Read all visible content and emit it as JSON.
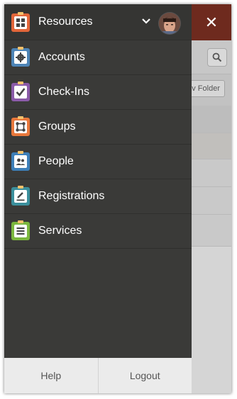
{
  "header": {
    "title": "Resources",
    "close_glyph": "✕"
  },
  "app_background": {
    "new_folder_label": "v Folder",
    "header_color": "#6e2a1e"
  },
  "menu": {
    "items": [
      {
        "label": "Resources",
        "icon": "resources-grid-icon",
        "color": "#e2663a"
      },
      {
        "label": "Accounts",
        "icon": "accounts-gear-icon",
        "color": "#4d84b6"
      },
      {
        "label": "Check-Ins",
        "icon": "check-ins-checkmark-icon",
        "color": "#8a5aa8"
      },
      {
        "label": "Groups",
        "icon": "groups-network-icon",
        "color": "#e8783c"
      },
      {
        "label": "People",
        "icon": "people-users-icon",
        "color": "#3d7fb8"
      },
      {
        "label": "Registrations",
        "icon": "registrations-pencil-icon",
        "color": "#3b8f9c"
      },
      {
        "label": "Services",
        "icon": "services-list-icon",
        "color": "#7bb73e"
      }
    ]
  },
  "footer": {
    "help_label": "Help",
    "logout_label": "Logout"
  }
}
